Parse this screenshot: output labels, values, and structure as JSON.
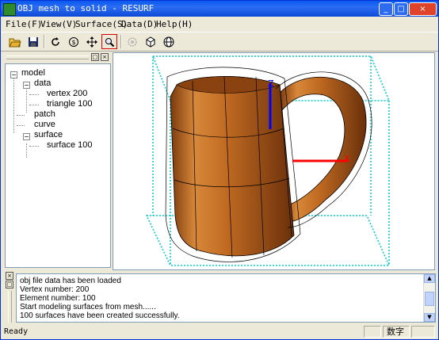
{
  "window": {
    "title": "OBJ mesh to solid - RESURF",
    "controls": {
      "minimize": "_",
      "maximize": "□",
      "close": "×"
    }
  },
  "menu": [
    "File(F)",
    "View(V)",
    "Surface(S)",
    "Data(D)",
    "Help(H)"
  ],
  "toolbar": [
    "open-folder-icon",
    "save-icon",
    "rotate-icon",
    "pan-icon",
    "move-icon",
    "zoom-window-icon",
    "mesh-icon",
    "box-view-icon",
    "globe-icon"
  ],
  "tree": {
    "model": "model",
    "data": "data",
    "vertex": "vertex 200",
    "triangle": "triangle 100",
    "patch": "patch",
    "curve": "curve",
    "surface": "surface",
    "surface_child": "surface 100"
  },
  "viewport": {
    "z_axis_label": "Z",
    "x_axis_label": "X",
    "colors": {
      "mug": "#b8651e",
      "bbox": "#00cccc",
      "z_axis": "#0000ff",
      "x_axis": "#ff0000"
    }
  },
  "output": {
    "lines": [
      "obj file data has been loaded",
      "Vertex number: 200",
      "Element number: 100",
      "Start modeling surfaces from mesh......",
      "100 surfaces have been created successfully."
    ]
  },
  "status": {
    "text": "Ready",
    "ime": "数字"
  }
}
